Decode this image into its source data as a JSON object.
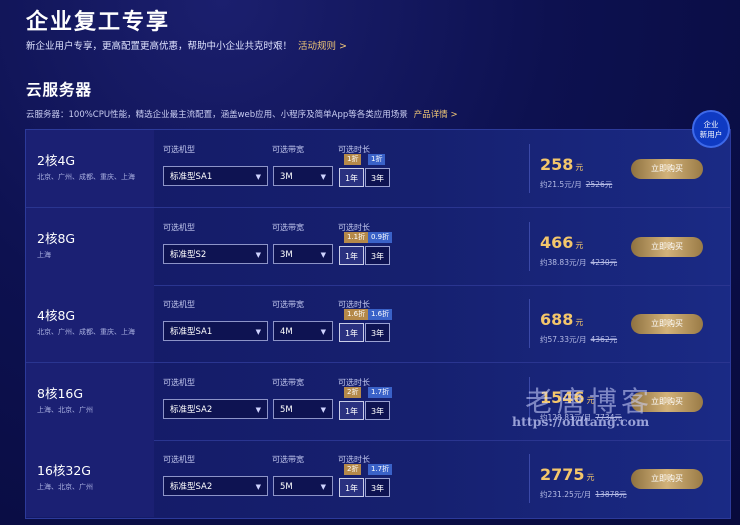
{
  "hero": {
    "title": "企业复工专享",
    "subtitle": "新企业用户专享，更高配置更高优惠，帮助中小企业共克时艰！",
    "link": "活动规则 >"
  },
  "section": {
    "title": "云服务器",
    "desc": "云服务器：100%CPU性能，精选企业最主流配置，涵盖web应用、小程序及简单App等各类应用场景",
    "link": "产品详情 >"
  },
  "corner_badge": {
    "line1": "企业",
    "line2": "新用户"
  },
  "labels": {
    "type": "可选机型",
    "bandwidth": "可选带宽",
    "duration": "可选时长",
    "year1": "1年",
    "year3": "3年",
    "buy": "立即购买",
    "yuan": "元"
  },
  "rows": [
    {
      "spec": "2核4G",
      "regions": "北京、广州、成都、重庆、上海",
      "type": "标准型SA1",
      "bandwidth": "3M",
      "badge1": "1折",
      "badge3": "1折",
      "price": "258",
      "monthly": "约21.5元/月",
      "original": "2526元"
    },
    {
      "spec": "2核8G",
      "regions": "上海",
      "type": "标准型S2",
      "bandwidth": "3M",
      "badge1": "1.1折",
      "badge3": "0.9折",
      "price": "466",
      "monthly": "约38.83元/月",
      "original": "4230元"
    },
    {
      "spec": "4核8G",
      "regions": "北京、广州、成都、重庆、上海",
      "type": "标准型SA1",
      "bandwidth": "4M",
      "badge1": "1.6折",
      "badge3": "1.6折",
      "price": "688",
      "monthly": "约57.33元/月",
      "original": "4362元"
    },
    {
      "spec": "8核16G",
      "regions": "上海、北京、广州",
      "type": "标准型SA2",
      "bandwidth": "5M",
      "badge1": "2折",
      "badge3": "1.7折",
      "price": "1546",
      "monthly": "约128.83元/月",
      "original": "7734元"
    },
    {
      "spec": "16核32G",
      "regions": "上海、北京、广州",
      "type": "标准型SA2",
      "bandwidth": "5M",
      "badge1": "2折",
      "badge3": "1.7折",
      "price": "2775",
      "monthly": "约231.25元/月",
      "original": "13878元"
    }
  ],
  "watermark": {
    "text": "老唐博客",
    "url": "https://oldtang.com"
  }
}
